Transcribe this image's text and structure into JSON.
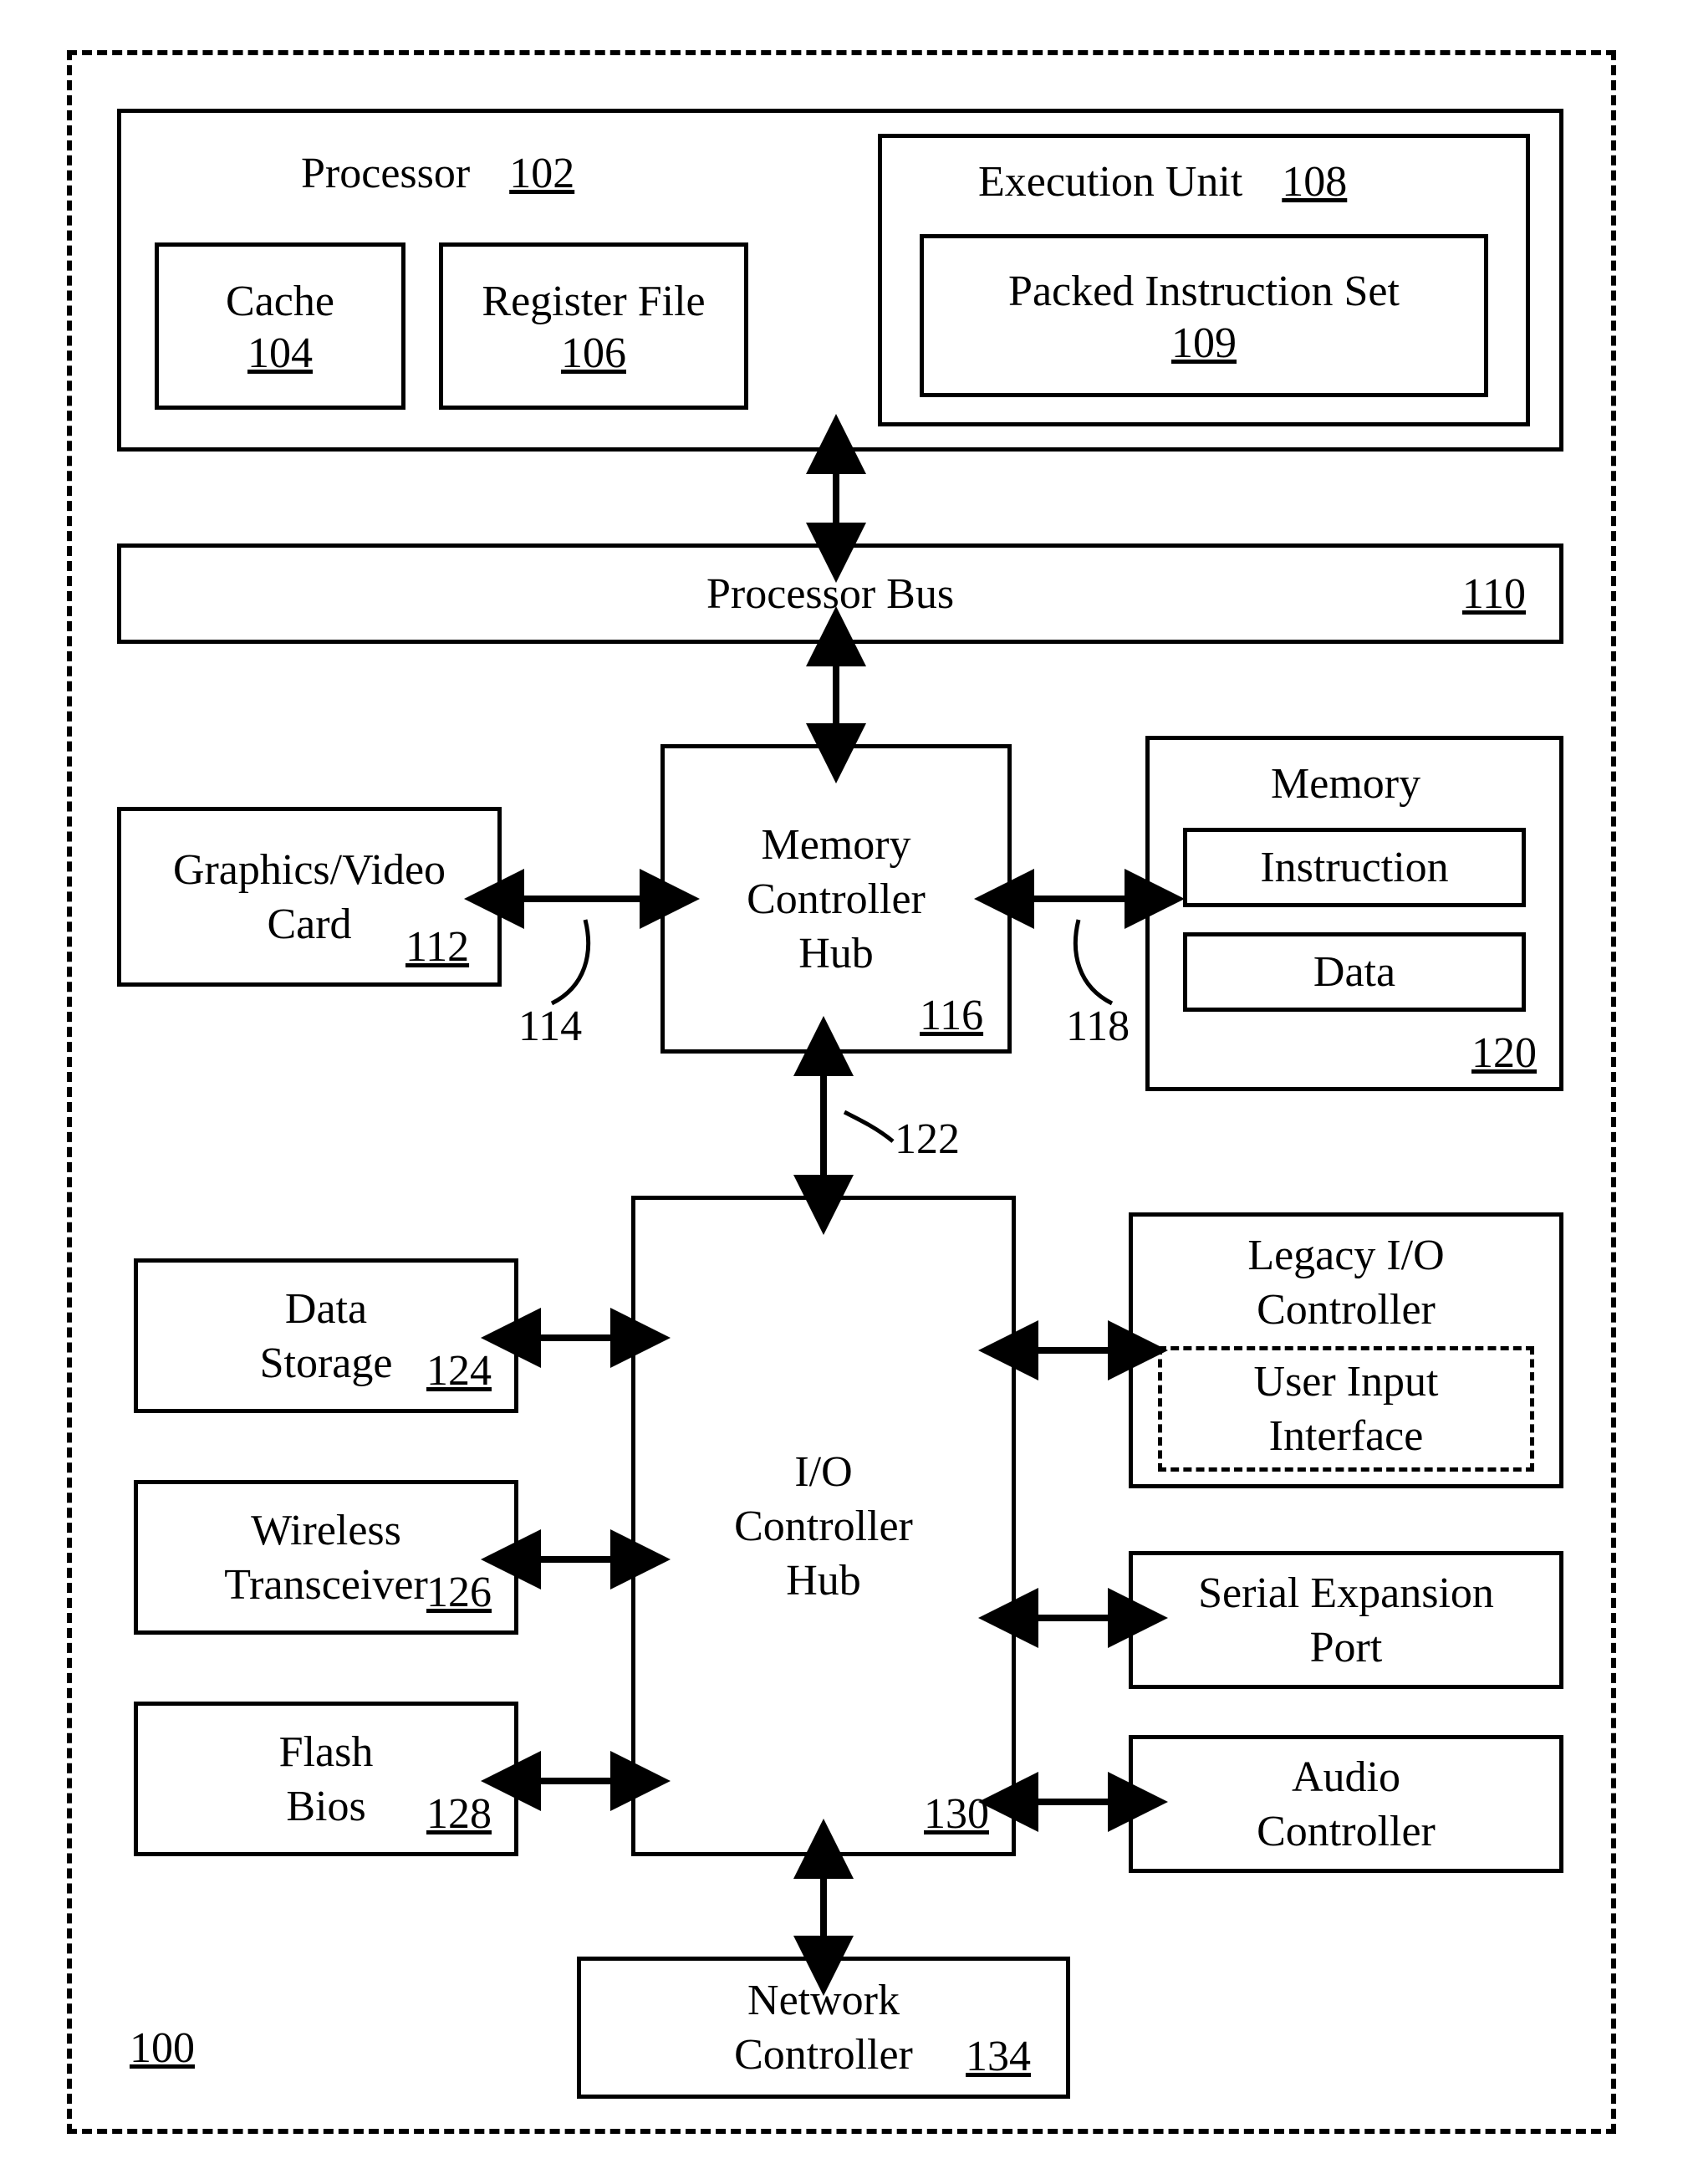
{
  "diagram": {
    "system_ref": "100",
    "processor": {
      "label": "Processor",
      "ref": "102"
    },
    "cache": {
      "label": "Cache",
      "ref": "104"
    },
    "register_file": {
      "label": "Register File",
      "ref": "106"
    },
    "execution_unit": {
      "label": "Execution Unit",
      "ref": "108"
    },
    "packed_instruction_set": {
      "label": "Packed Instruction Set",
      "ref": "109"
    },
    "processor_bus": {
      "label": "Processor Bus",
      "ref": "110"
    },
    "graphics_card": {
      "label": "Graphics/Video\nCard",
      "ref": "112"
    },
    "mch_link_left": "114",
    "memory_controller_hub": {
      "label": "Memory\nController\nHub",
      "ref": "116"
    },
    "mch_link_right": "118",
    "memory": {
      "label": "Memory",
      "ref": "120"
    },
    "memory_instruction": {
      "label": "Instruction"
    },
    "memory_data": {
      "label": "Data"
    },
    "hub_link": "122",
    "data_storage": {
      "label": "Data\nStorage",
      "ref": "124"
    },
    "wireless_transceiver": {
      "label": "Wireless\nTransceiver",
      "ref": "126"
    },
    "flash_bios": {
      "label": "Flash\nBios",
      "ref": "128"
    },
    "io_controller_hub": {
      "label": "I/O\nController\nHub",
      "ref": "130"
    },
    "legacy_io": {
      "label": "Legacy I/O\nController"
    },
    "user_input_interface": {
      "label": "User Input\nInterface"
    },
    "serial_expansion_port": {
      "label": "Serial Expansion\nPort"
    },
    "audio_controller": {
      "label": "Audio\nController"
    },
    "network_controller": {
      "label": "Network\nController",
      "ref": "134"
    }
  }
}
